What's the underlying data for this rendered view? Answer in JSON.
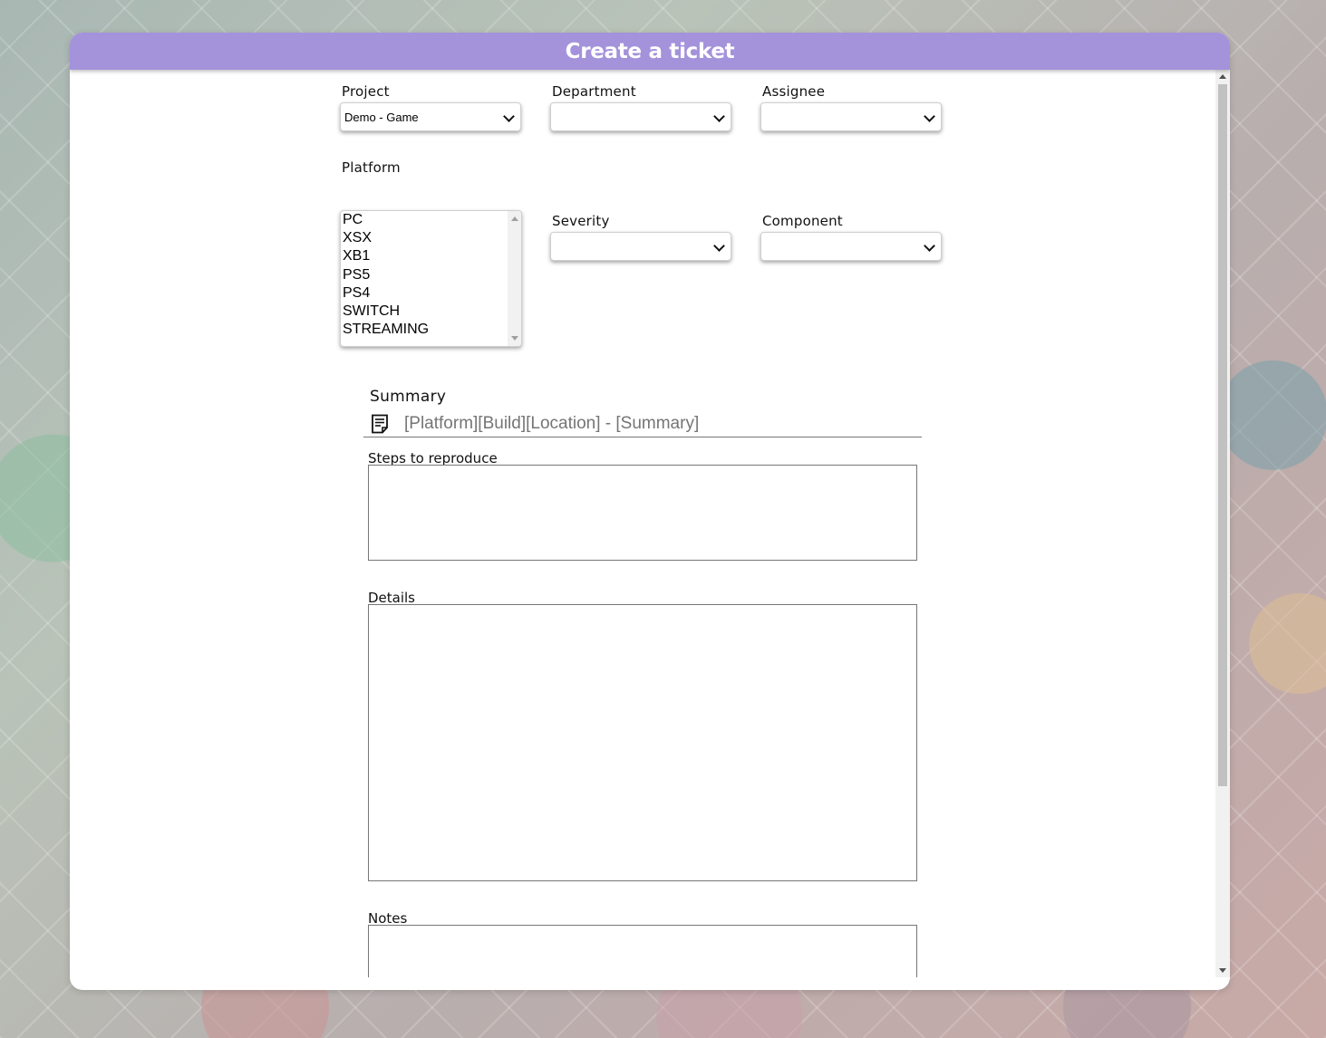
{
  "header": {
    "title": "Create a ticket"
  },
  "fields": {
    "project": {
      "label": "Project",
      "value": "Demo - Game"
    },
    "department": {
      "label": "Department",
      "value": ""
    },
    "assignee": {
      "label": "Assignee",
      "value": ""
    },
    "platform": {
      "label": "Platform",
      "options": [
        "PC",
        "XSX",
        "XB1",
        "PS5",
        "PS4",
        "SWITCH",
        "STREAMING"
      ]
    },
    "severity": {
      "label": "Severity",
      "value": ""
    },
    "component": {
      "label": "Component",
      "value": ""
    }
  },
  "summary": {
    "label": "Summary",
    "placeholder": "[Platform][Build][Location] - [Summary]",
    "icon": "document-icon"
  },
  "steps": {
    "label": "Steps to reproduce"
  },
  "details": {
    "label": "Details"
  },
  "notes": {
    "label": "Notes"
  }
}
